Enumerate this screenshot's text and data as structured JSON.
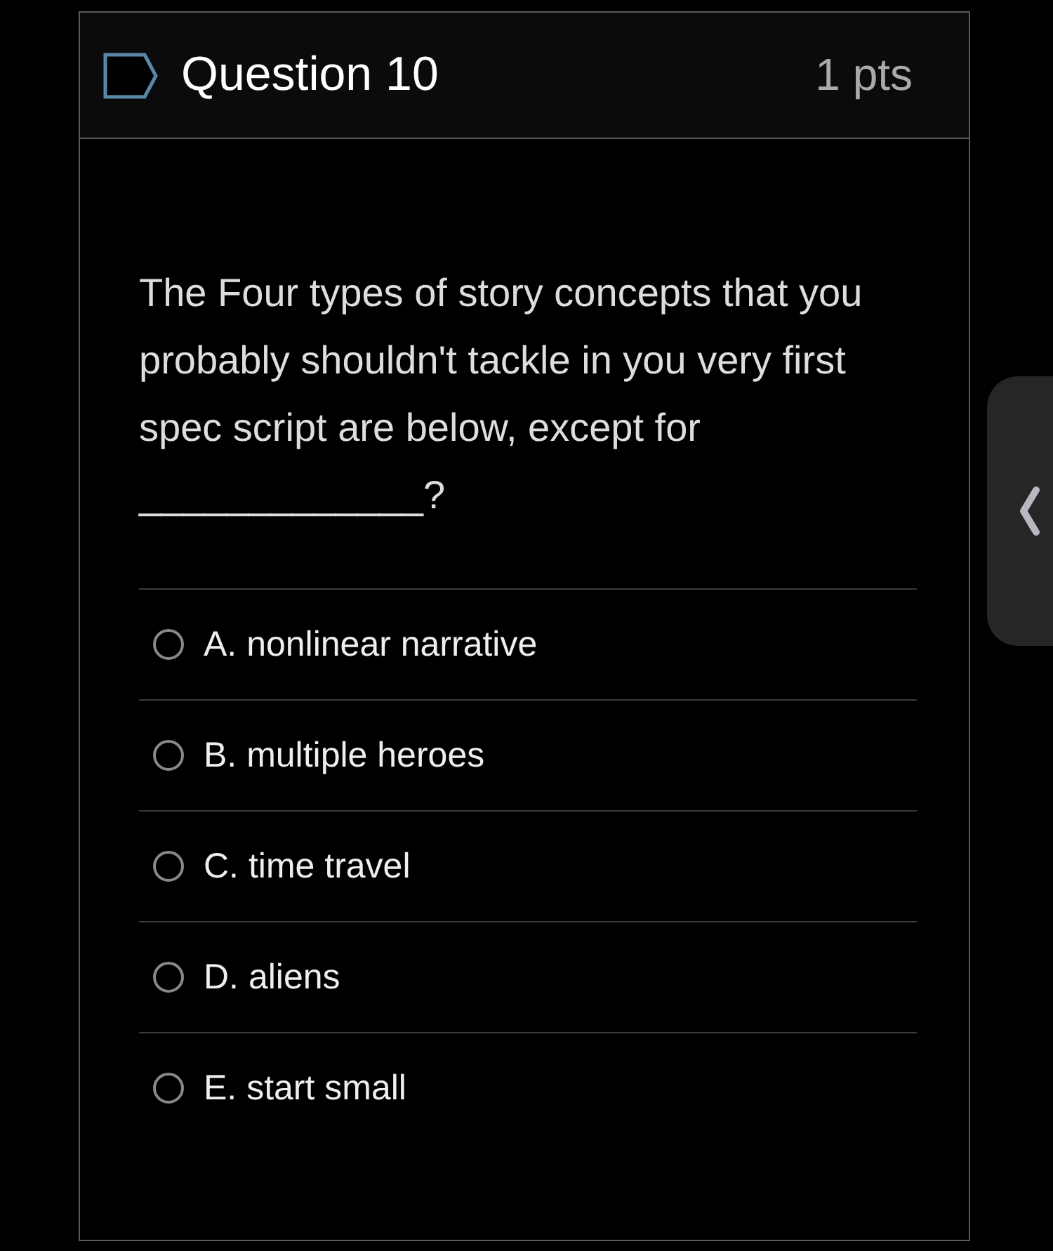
{
  "question": {
    "title": "Question 10",
    "points": "1 pts",
    "text": "The Four types of story concepts that you probably shouldn't tackle in you very first spec script are below, except for _____________?"
  },
  "options": [
    {
      "label": "A. nonlinear narrative",
      "selected": false
    },
    {
      "label": "B. multiple heroes",
      "selected": false
    },
    {
      "label": "C. time travel",
      "selected": false
    },
    {
      "label": "D. aliens",
      "selected": false
    },
    {
      "label": "E. start small",
      "selected": false
    }
  ]
}
